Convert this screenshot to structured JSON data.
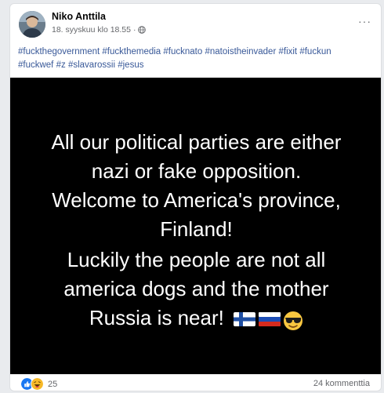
{
  "post": {
    "author": "Niko Anttila",
    "timestamp": "18. syyskuu klo 18.55",
    "separator": "·",
    "privacy_icon": "globe-icon",
    "more_label": "···",
    "hashtags": [
      "#fuckthegovernment",
      "#fuckthemedia",
      "#fucknato",
      "#natoistheinvader",
      "#fixit",
      "#fuckun",
      "#fuckwef",
      "#z",
      "#slavarossii",
      "#jesus"
    ],
    "image_text": {
      "para1": [
        "All our political parties are either",
        "nazi or fake opposition.",
        "Welcome to America's province,",
        "Finland!"
      ],
      "para2": [
        "Luckily the people are not all",
        "america dogs and the mother",
        "Russia is near!"
      ],
      "emojis": [
        "flag-finland-icon",
        "flag-russia-icon",
        "sunglasses-face-icon"
      ]
    }
  },
  "footer": {
    "reaction_icons": [
      "like-icon",
      "haha-icon"
    ],
    "reaction_count": "25",
    "comments_label": "24 kommenttia"
  },
  "colors": {
    "link": "#385898",
    "muted": "#65676b",
    "like_blue": "#1877f2",
    "haha_yellow": "#f7b928"
  }
}
